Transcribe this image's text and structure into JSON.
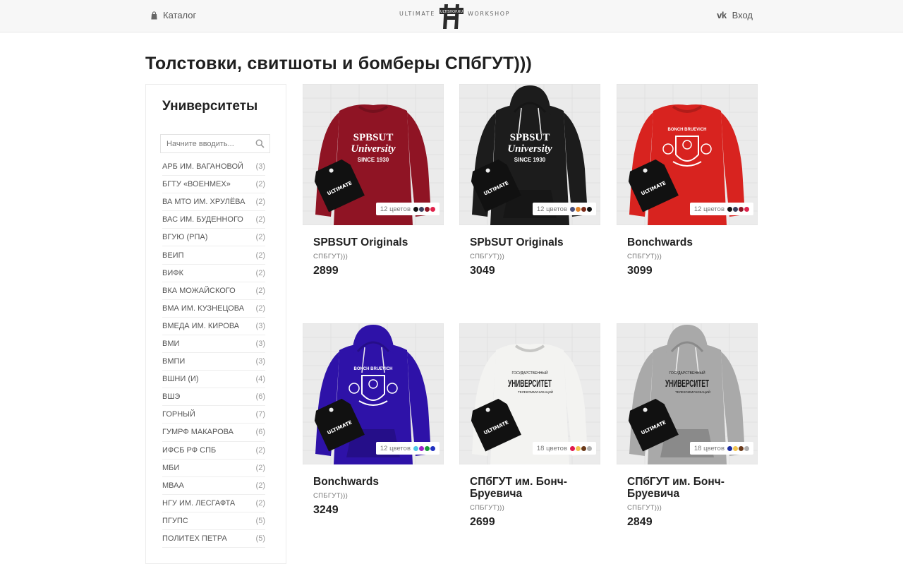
{
  "header": {
    "catalog_label": "Каталог",
    "login_label": "Вход",
    "logo_left": "ULTIMATE",
    "logo_right": "WORKSHOP",
    "logo_mark_text": "ULTISHOP.RU"
  },
  "page_title": "Толстовки, свитшоты и бомберы СПбГУТ)))",
  "sidebar": {
    "title": "Университеты",
    "search_placeholder": "Начните вводить...",
    "items": [
      {
        "label": "АРБ им. Вагановой",
        "count": "(3)"
      },
      {
        "label": "БГТУ «Военмех»",
        "count": "(2)"
      },
      {
        "label": "ВА МТО им. Хрулёва",
        "count": "(2)"
      },
      {
        "label": "ВАС им. Буденного",
        "count": "(2)"
      },
      {
        "label": "ВГУЮ (РПА)",
        "count": "(2)"
      },
      {
        "label": "ВЕИП",
        "count": "(2)"
      },
      {
        "label": "ВИФК",
        "count": "(2)"
      },
      {
        "label": "ВКА Можайского",
        "count": "(2)"
      },
      {
        "label": "ВМА им. Кузнецова",
        "count": "(2)"
      },
      {
        "label": "ВМедА им. Кирова",
        "count": "(3)"
      },
      {
        "label": "ВМИ",
        "count": "(3)"
      },
      {
        "label": "ВМПИ",
        "count": "(3)"
      },
      {
        "label": "ВШНИ (И)",
        "count": "(4)"
      },
      {
        "label": "ВШЭ",
        "count": "(6)"
      },
      {
        "label": "Горный",
        "count": "(7)"
      },
      {
        "label": "ГУМРФ Макарова",
        "count": "(6)"
      },
      {
        "label": "ИФСБ РФ СПБ",
        "count": "(2)"
      },
      {
        "label": "МБИ",
        "count": "(2)"
      },
      {
        "label": "МВАА",
        "count": "(2)"
      },
      {
        "label": "НГУ им. Лесгафта",
        "count": "(2)"
      },
      {
        "label": "ПГУПС",
        "count": "(5)"
      },
      {
        "label": "Политех Петра",
        "count": "(5)"
      }
    ]
  },
  "products": [
    {
      "name": "SPBSUT Originals",
      "sub": "СПБГУТ)))",
      "price": "2899",
      "colors_label": "12 цветов",
      "garment_color": "#8f1424",
      "style": "sweatshirt",
      "print": "SPBSUT",
      "swatches": [
        "#111111",
        "#3b3f5c",
        "#8f1424",
        "#e0214a"
      ]
    },
    {
      "name": "SPbSUT Originals",
      "sub": "СПБГУТ)))",
      "price": "3049",
      "colors_label": "12 цветов",
      "garment_color": "#1c1c1c",
      "style": "hoodie",
      "print": "SPBSUT",
      "swatches": [
        "#4a4f7a",
        "#e0842a",
        "#7a2a18",
        "#111111"
      ]
    },
    {
      "name": "Bonchwards",
      "sub": "СПБГУТ)))",
      "price": "3099",
      "colors_label": "12 цветов",
      "garment_color": "#d8231f",
      "style": "sweatshirt",
      "print": "crest",
      "swatches": [
        "#111111",
        "#3b3f5c",
        "#8f1424",
        "#e0214a"
      ]
    },
    {
      "name": "Bonchwards",
      "sub": "СПБГУТ)))",
      "price": "3249",
      "colors_label": "12 цветов",
      "garment_color": "#2e12a8",
      "style": "hoodie",
      "print": "crest",
      "swatches": [
        "#4ec8e8",
        "#a020c8",
        "#1a9a3a",
        "#2030c0"
      ]
    },
    {
      "name": "СПбГУТ им. Бонч-Бруевича",
      "sub": "СПБГУТ)))",
      "price": "2699",
      "colors_label": "18 цветов",
      "garment_color": "#f3f3f1",
      "style": "sweatshirt",
      "print": "word",
      "swatches": [
        "#e01a4f",
        "#f2c450",
        "#6b3a1a",
        "#b0b0b0"
      ]
    },
    {
      "name": "СПбГУТ им. Бонч-Бруевича",
      "sub": "СПБГУТ)))",
      "price": "2849",
      "colors_label": "18 цветов",
      "garment_color": "#a9a9a9",
      "style": "hoodie",
      "print": "word",
      "swatches": [
        "#1a2aa0",
        "#f2c450",
        "#6b3a1a",
        "#b0b0b0"
      ]
    }
  ],
  "print_texts": {
    "spbsut_top": "SPBSUT",
    "spbsut_script": "University",
    "spbsut_since": "SINCE 1930",
    "word_small": "ГОСУДАРСТВЕННЫЙ",
    "word_big": "УНИВЕРСИТЕТ",
    "word_bottom": "ТЕЛЕКОММУНИКАЦИЙ",
    "crest_top": "BONCH BRUEVICH",
    "tag_text": "ULTIMATE"
  }
}
